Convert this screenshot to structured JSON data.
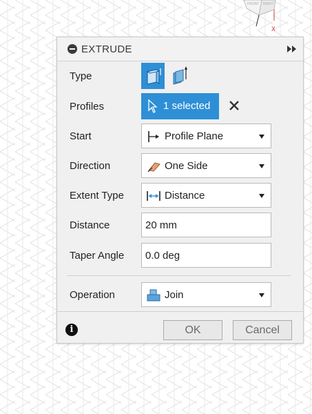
{
  "dialog": {
    "title": "EXTRUDE",
    "type": {
      "label": "Type",
      "options": [
        "solid-extrude-icon",
        "thin-extrude-icon"
      ],
      "selected": "solid-extrude-icon"
    },
    "profiles": {
      "label": "Profiles",
      "value": "1 selected"
    },
    "start": {
      "label": "Start",
      "value": "Profile Plane",
      "icon": "profile-plane-icon"
    },
    "direction": {
      "label": "Direction",
      "value": "One Side",
      "icon": "one-side-icon"
    },
    "extent_type": {
      "label": "Extent Type",
      "value": "Distance",
      "icon": "distance-icon"
    },
    "distance": {
      "label": "Distance",
      "value": "20 mm"
    },
    "taper_angle": {
      "label": "Taper Angle",
      "value": "0.0 deg"
    },
    "operation": {
      "label": "Operation",
      "value": "Join",
      "icon": "join-icon"
    },
    "ok_label": "OK",
    "cancel_label": "Cancel"
  },
  "viewcube": {
    "face_labels": [
      "RIGHT",
      "FRONT"
    ],
    "axis_label": "X"
  },
  "colors": {
    "accent": "#2e8fd6",
    "panel": "#f0f0f0",
    "grid": "#d9d9d9"
  }
}
